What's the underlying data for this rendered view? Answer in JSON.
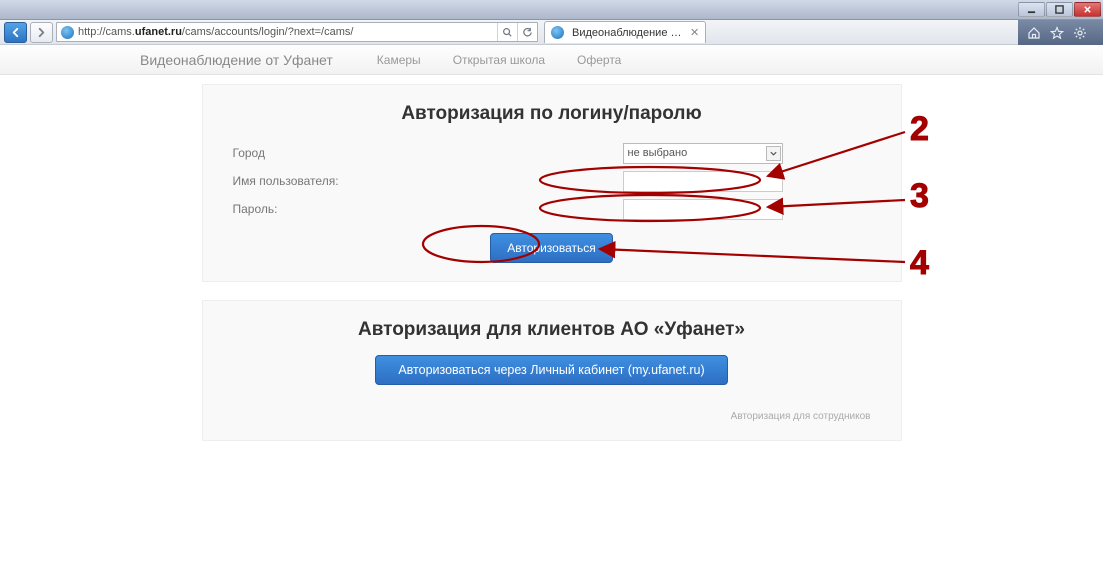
{
  "window": {
    "minimize_tip": "Minimize",
    "maximize_tip": "Maximize",
    "close_tip": "Close"
  },
  "browser": {
    "url_prefix": "http://cams.",
    "url_bold": "ufanet.ru",
    "url_suffix": "/cams/accounts/login/?next=/cams/",
    "tab_title": "Видеонаблюдение от Уфа...",
    "home_tip": "Home",
    "favorites_tip": "Favorites",
    "tools_tip": "Tools"
  },
  "nav": {
    "brand": "Видеонаблюдение от Уфанет",
    "links": [
      "Камеры",
      "Открытая школа",
      "Оферта"
    ]
  },
  "login": {
    "heading": "Авторизация по логину/паролю",
    "city_label": "Город",
    "city_selected": "не выбрано",
    "username_label": "Имя пользователя:",
    "password_label": "Пароль:",
    "submit_label": "Авторизоваться"
  },
  "client": {
    "heading": "Авторизация для клиентов АО «Уфанет»",
    "button_label": "Авторизоваться через Личный кабинет (my.ufanet.ru)",
    "staff_link": "Авторизация для сотрудников"
  },
  "annotations": {
    "n2": "2",
    "n3": "3",
    "n4": "4"
  }
}
